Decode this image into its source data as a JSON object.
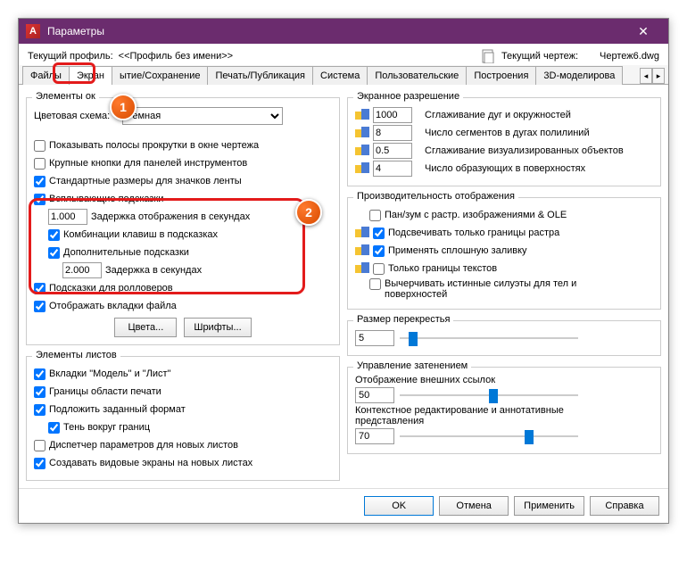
{
  "title": "Параметры",
  "profile_label": "Текущий профиль:",
  "profile_value": "<<Профиль без имени>>",
  "drawing_label": "Текущий чертеж:",
  "drawing_value": "Чертеж6.dwg",
  "tabs": {
    "files": "Файлы",
    "screen": "Экран",
    "open_save": "ытие/Сохранение",
    "print": "Печать/Публикация",
    "system": "Система",
    "user": "Пользовательские",
    "build": "Построения",
    "three_d": "3D-моделирова"
  },
  "left": {
    "g1": {
      "title": "Элементы ок",
      "scheme_label": "Цветовая схема:",
      "scheme_value": "Темная",
      "scrollbars": "Показывать полосы прокрутки в окне чертежа",
      "big_buttons": "Крупные кнопки для панелей инструментов",
      "std_sizes": "Стандартные размеры для значков ленты",
      "tooltips": "Всплывающие подсказки",
      "delay1_val": "1.000",
      "delay1_lbl": "Задержка отображения в секундах",
      "keycombos": "Комбинации клавиш в подсказках",
      "extra_tips": "Дополнительные подсказки",
      "delay2_val": "2.000",
      "delay2_lbl": "Задержка в секундах",
      "rollover": "Подсказки для ролловеров",
      "show_tabs": "Отображать вкладки файла",
      "colors_btn": "Цвета...",
      "fonts_btn": "Шрифты..."
    },
    "g2": {
      "title": "Элементы листов",
      "modellayout": "Вкладки \"Модель\" и \"Лист\"",
      "print_bounds": "Границы области печати",
      "underlay": "Подложить заданный формат",
      "shadow": "Тень вокруг границ",
      "dispatcher": "Диспетчер параметров для новых листов",
      "viewports": "Создавать видовые экраны на новых листах"
    }
  },
  "right": {
    "g1": {
      "title": "Экранное разрешение",
      "r1_val": "1000",
      "r1_lbl": "Сглаживание дуг и окружностей",
      "r2_val": "8",
      "r2_lbl": "Число сегментов в дугах полилиний",
      "r3_val": "0.5",
      "r3_lbl": "Сглаживание визуализированных объектов",
      "r4_val": "4",
      "r4_lbl": "Число образующих в поверхностях"
    },
    "g2": {
      "title": "Производительность отображения",
      "o1": "Пан/зум с растр. изображениями & OLE",
      "o2": "Подсвечивать только границы растра",
      "o3": "Применять сплошную заливку",
      "o4": "Только границы текстов",
      "o5": "Вычерчивать истинные силуэты для тел и поверхностей"
    },
    "g3": {
      "title": "Размер перекрестья",
      "val": "5",
      "pct": 5
    },
    "g4": {
      "title": "Управление затенением",
      "l1": "Отображение внешних ссылок",
      "v1": "50",
      "p1": 50,
      "l2": "Контекстное редактирование и аннотативные представления",
      "v2": "70",
      "p2": 70
    }
  },
  "footer": {
    "ok": "OK",
    "cancel": "Отмена",
    "apply": "Применить",
    "help": "Справка"
  },
  "callout": {
    "one": "1",
    "two": "2"
  }
}
